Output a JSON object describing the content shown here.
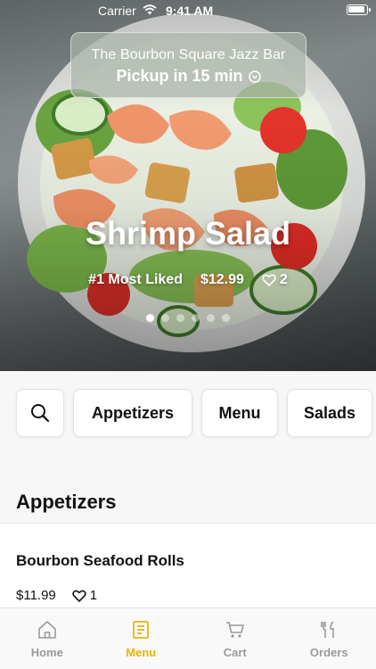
{
  "status_bar": {
    "carrier": "Carrier",
    "time": "9:41 AM"
  },
  "pickup": {
    "venue": "The Bourbon Square Jazz Bar",
    "time_label": "Pickup in 15 min"
  },
  "featured": {
    "title": "Shrimp Salad",
    "badge": "#1 Most Liked",
    "price": "$12.99",
    "likes": "2",
    "page_count": 6,
    "active_page": 1
  },
  "categories": {
    "search_icon": "search-icon",
    "items": [
      "Appetizers",
      "Menu",
      "Salads"
    ]
  },
  "section": {
    "title": "Appetizers",
    "items": [
      {
        "name": "Bourbon Seafood Rolls",
        "price": "$11.99",
        "likes": "1"
      }
    ]
  },
  "tabs": [
    {
      "label": "Home",
      "icon": "home-icon"
    },
    {
      "label": "Menu",
      "icon": "menu-icon",
      "active": true
    },
    {
      "label": "Cart",
      "icon": "cart-icon"
    },
    {
      "label": "Orders",
      "icon": "orders-icon"
    }
  ],
  "colors": {
    "accent": "#e6b800",
    "inactive": "#9a9a9e"
  }
}
